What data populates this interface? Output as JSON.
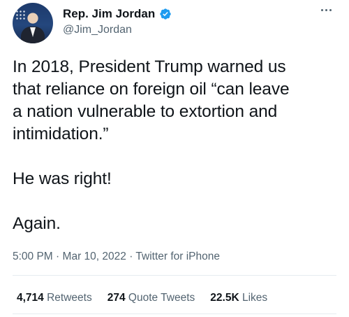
{
  "author": {
    "display_name": "Rep. Jim Jordan",
    "handle": "@Jim_Jordan",
    "verified": true,
    "verified_color": "#1d9bf0"
  },
  "tweet": {
    "lines": [
      "In 2018, President Trump warned us",
      "that reliance on foreign oil “can leave",
      "a nation vulnerable to extortion and",
      "intimidation.”"
    ],
    "line_2": "He was right!",
    "line_3": "Again."
  },
  "meta": {
    "time": "5:00 PM",
    "separator": "·",
    "date": "Mar 10, 2022",
    "source": "Twitter for iPhone"
  },
  "stats": {
    "retweets_count": "4,714",
    "retweets_label": "Retweets",
    "quote_count": "274",
    "quote_label": "Quote Tweets",
    "likes_count": "22.5K",
    "likes_label": "Likes"
  },
  "icons": {
    "more": "more-horizontal-icon",
    "verified": "verified-badge-icon"
  }
}
